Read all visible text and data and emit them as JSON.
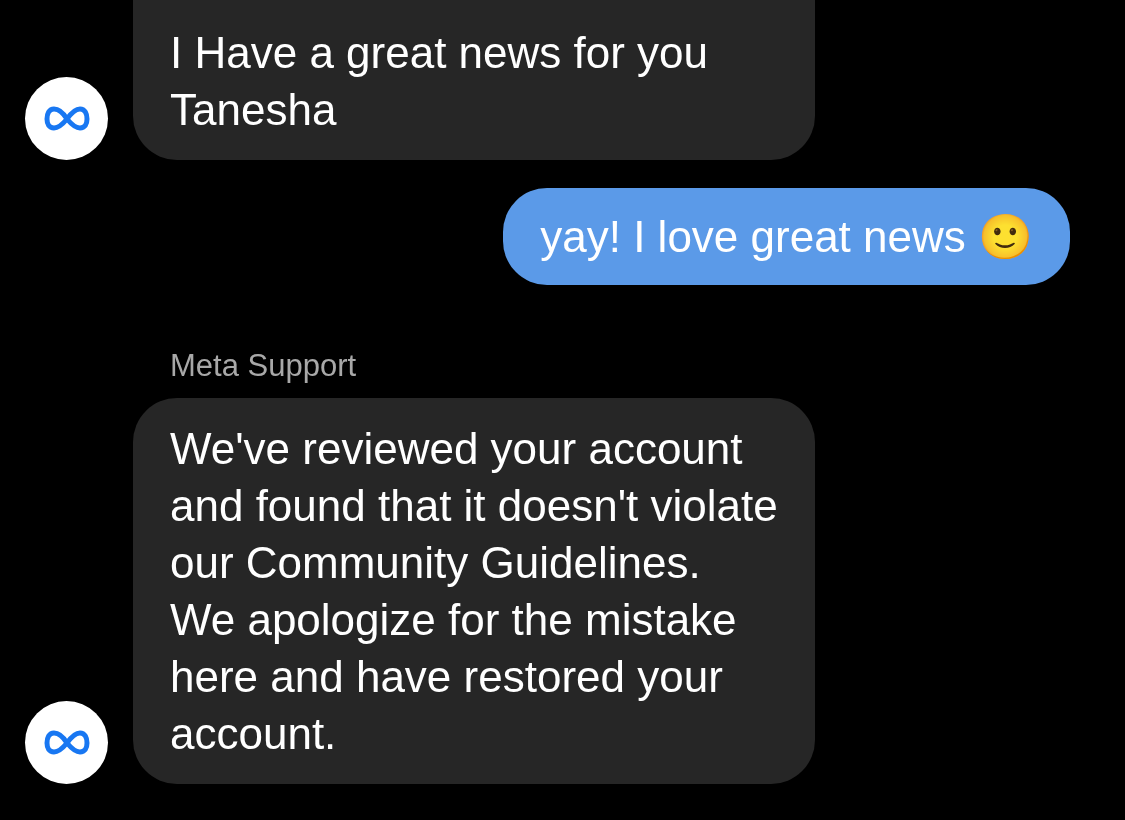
{
  "messages": [
    {
      "kind": "incoming",
      "text": "I Have a great news for you Tanesha",
      "avatar": true
    },
    {
      "kind": "outgoing",
      "text": "yay! I love great news 🙂",
      "avatar": false
    },
    {
      "kind": "incoming",
      "sender": "Meta Support",
      "text": "We've reviewed your account and found that it doesn't violate our Community Guidelines. We apologize for the mistake here and have restored your account.",
      "avatar": true
    }
  ]
}
